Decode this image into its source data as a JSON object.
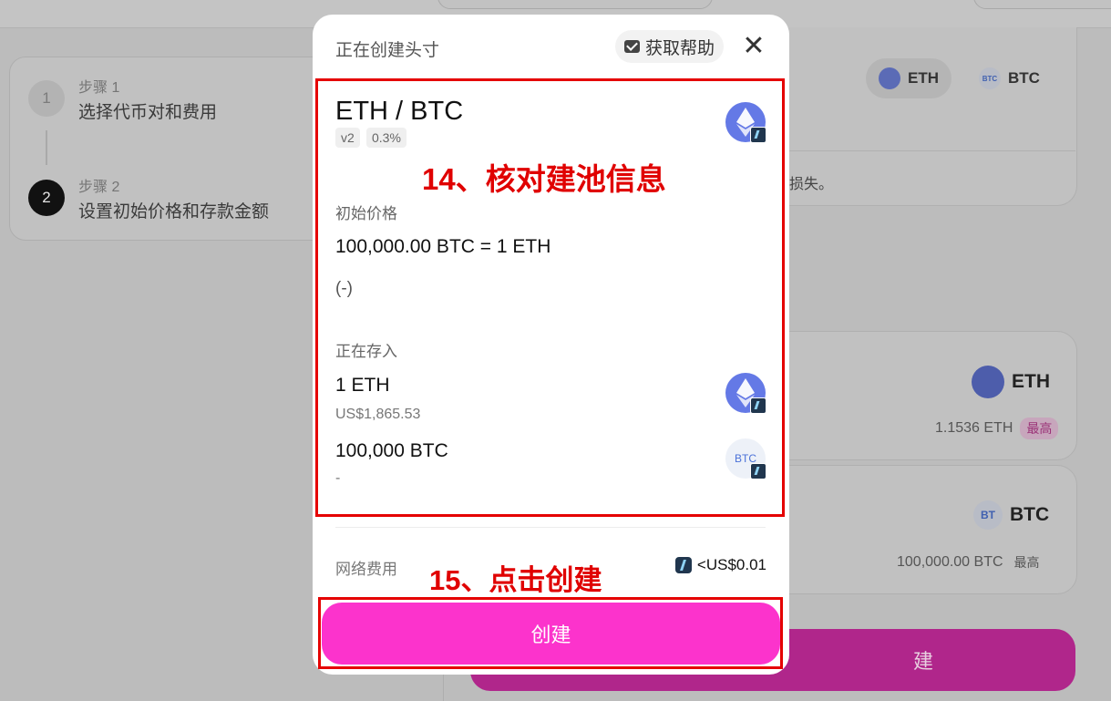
{
  "background": {
    "steps": [
      {
        "num": "1",
        "label": "步骤 1",
        "title": "选择代币对和费用"
      },
      {
        "num": "2",
        "label": "步骤 2",
        "title": "设置初始价格和存款金额"
      }
    ],
    "pair_selector": {
      "token_a": "ETH",
      "token_b": "BTC",
      "btc_icon_text": "BTC"
    },
    "loss_text_fragment": "损失。",
    "deposit_eth": {
      "symbol": "ETH",
      "balance": "1.1536 ETH",
      "max_label": "最高"
    },
    "deposit_btc": {
      "symbol": "BTC",
      "icon_text": "BT",
      "balance": "100,000.00 BTC",
      "max_label": "最高"
    },
    "bottom_button_fragment": "建"
  },
  "modal": {
    "title": "正在创建头寸",
    "help_label": "获取帮助",
    "close_symbol": "✕",
    "pair": "ETH / BTC",
    "version_tag": "v2",
    "fee_tag": "0.3%",
    "initial_price_label": "初始价格",
    "initial_price_value": "100,000.00 BTC = 1 ETH",
    "initial_price_usd": "(-)",
    "depositing_label": "正在存入",
    "deposit_eth_amount": "1  ETH",
    "deposit_eth_usd": "US$1,865.53",
    "deposit_btc_amount": "100,000  BTC",
    "deposit_btc_usd": "-",
    "btc_icon_text": "BTC",
    "network_fee_label": "网络费用",
    "network_fee_value": "<US$0.01",
    "create_button": "创建"
  },
  "annotations": {
    "step14": "14、核对建池信息",
    "step15": "15、点击创建",
    "color": "#e00000"
  },
  "colors": {
    "accent_pink": "#fc33cc",
    "eth_blue": "#6479e6"
  }
}
